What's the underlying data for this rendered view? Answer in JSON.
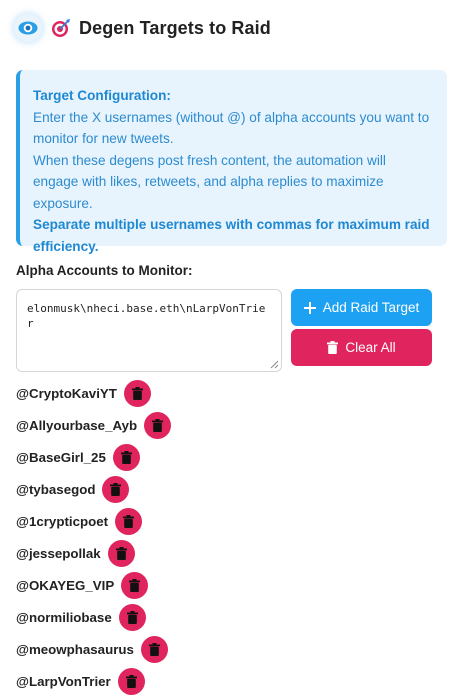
{
  "header": {
    "title": "Degen Targets to Raid",
    "eye_icon": "eye-icon",
    "target_icon": "dart-target-icon"
  },
  "info": {
    "heading": "Target Configuration:",
    "line1": "Enter the X usernames (without @) of alpha accounts you want to monitor for new tweets.",
    "line2": "When these degens post fresh content, the automation will engage with likes, retweets, and alpha replies to maximize exposure.",
    "emphasis": "Separate multiple usernames with commas for maximum raid efficiency."
  },
  "input": {
    "label": "Alpha Accounts to Monitor:",
    "value": "elonmusk\\nheci.base.eth\\nLarpVonTrier"
  },
  "buttons": {
    "add_label": "Add Raid Target",
    "clear_label": "Clear All"
  },
  "accounts": [
    "@CryptoKaviYT",
    "@Allyourbase_Ayb",
    "@BaseGirl_25",
    "@tybasegod",
    "@1crypticpoet",
    "@jessepollak",
    "@OKAYEG_VIP",
    "@normiliobase",
    "@meowphasaurus",
    "@LarpVonTrier"
  ],
  "colors": {
    "accent_blue": "#1da1f2",
    "danger_pink": "#e0245e",
    "info_bg": "#e8f4fd"
  }
}
